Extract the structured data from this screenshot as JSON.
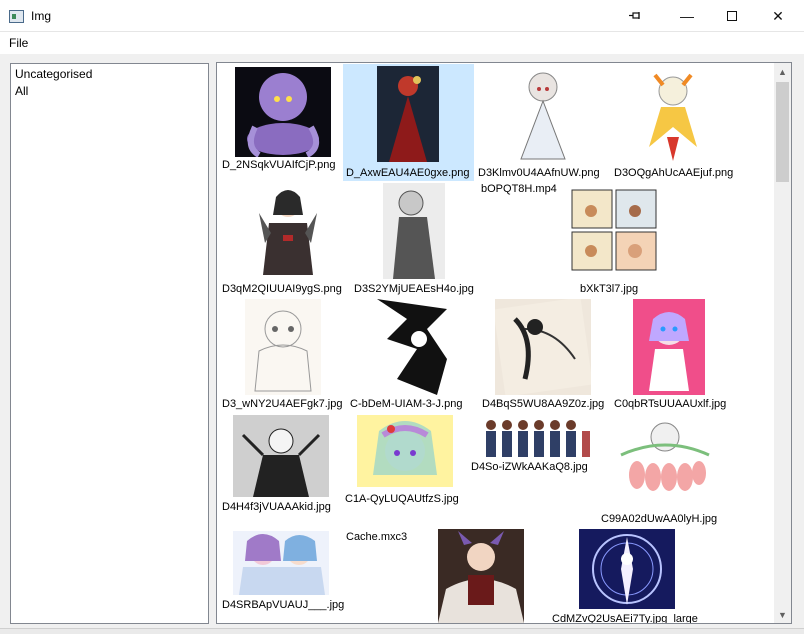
{
  "window": {
    "title": "Img",
    "pin_icon": "pin-icon",
    "minimize_glyph": "—",
    "close_glyph": "✕"
  },
  "menu": {
    "file": "File"
  },
  "categories": [
    "Uncategorised",
    "All"
  ],
  "images": [
    {
      "label": "D_2NSqkVUAIfCjP.png"
    },
    {
      "label": "D_AxwEAU4AE0gxe.png",
      "selected": true
    },
    {
      "label": "D3Klmv0U4AAfnUW.png"
    },
    {
      "label": "D3OQgAhUcAAEjuf.png"
    },
    {
      "label": "bOPQT8H.mp4"
    },
    {
      "label": "D3qM2QIUUAI9ygS.png"
    },
    {
      "label": "D3S2YMjUEAEsH4o.jpg"
    },
    {
      "label": "bXkT3l7.jpg"
    },
    {
      "label": "D3_wNY2U4AEFgk7.jpg"
    },
    {
      "label": "C-bDeM-UIAM-3-J.png"
    },
    {
      "label": "D4BqS5WU8AA9Z0z.jpg"
    },
    {
      "label": "C0qbRTsUUAAUxlf.jpg"
    },
    {
      "label": "D4H4f3jVUAAAkid.jpg"
    },
    {
      "label": "C1A-QyLUQAUtfzS.jpg"
    },
    {
      "label": "D4So-iZWkAAKaQ8.jpg"
    },
    {
      "label": "C99A02dUwAA0lyH.jpg"
    },
    {
      "label": "D4SRBApVUAUJ___.jpg"
    },
    {
      "label": "Cache.mxc3"
    },
    {
      "label": ""
    },
    {
      "label": "CdMZvQ2UsAEi7Ty.jpg_large"
    }
  ]
}
